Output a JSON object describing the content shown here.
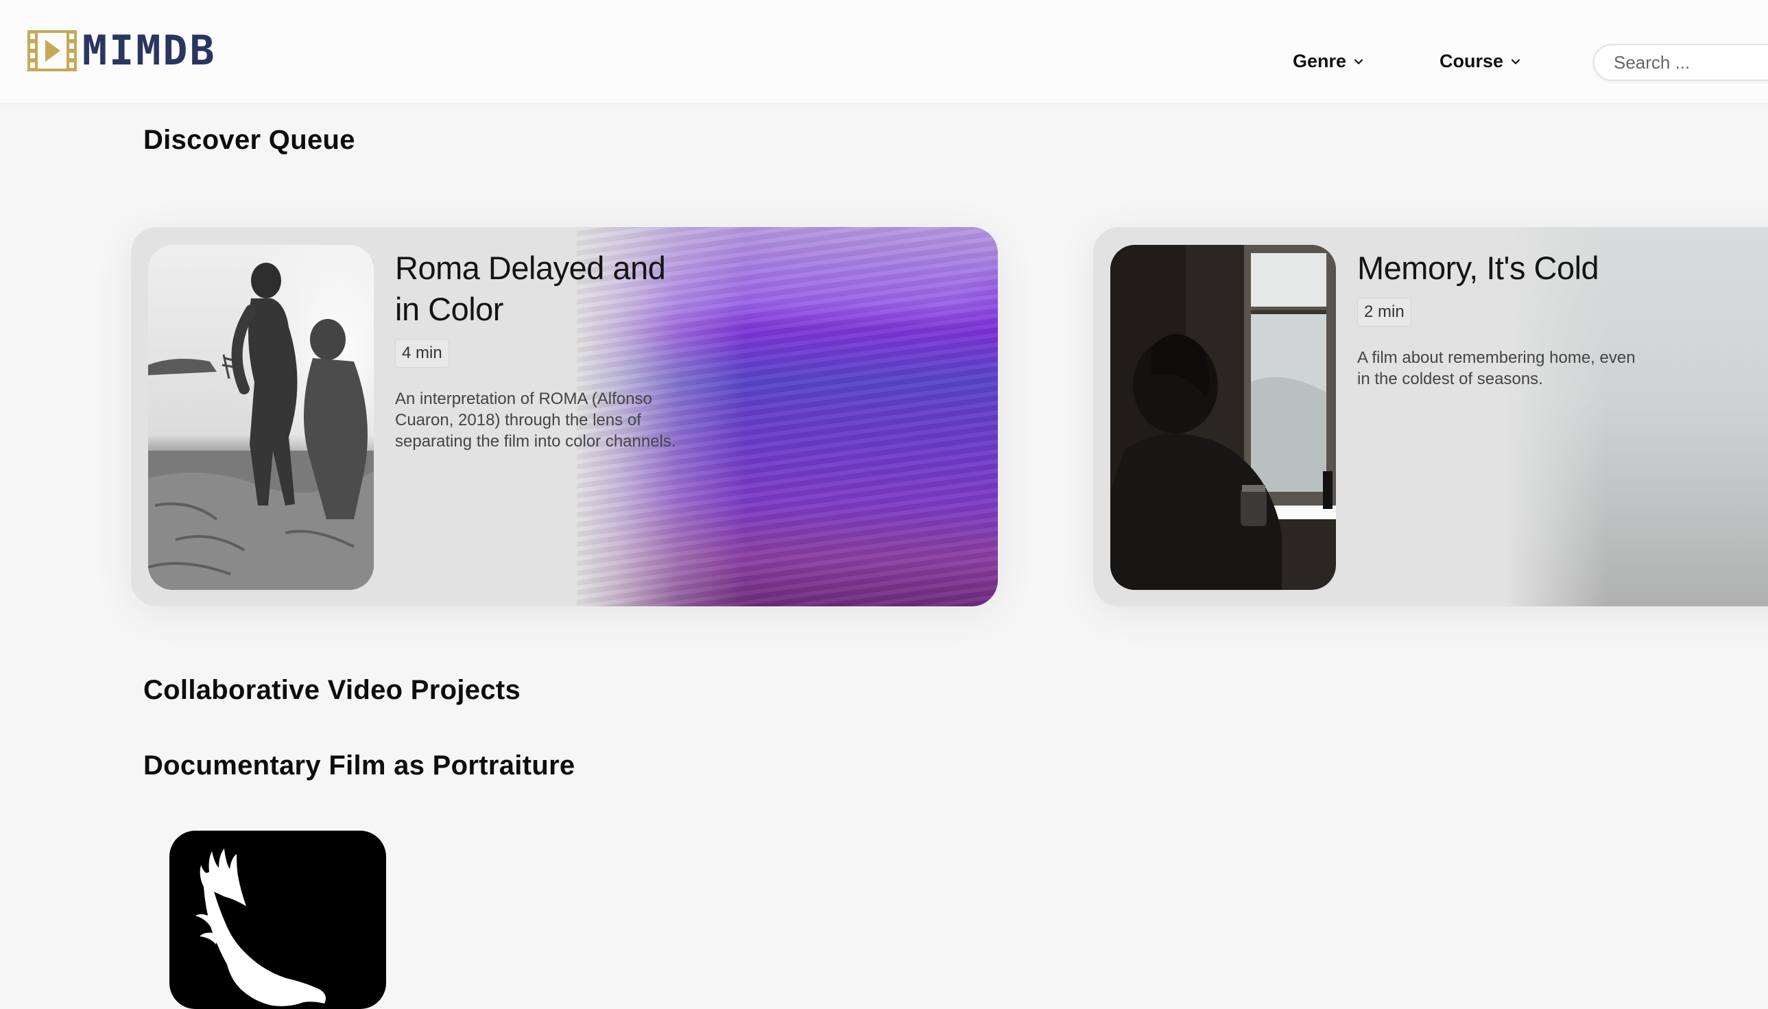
{
  "header": {
    "logo_text": "MIMDB",
    "logo_icon": "film-play-icon",
    "nav": [
      {
        "label": "Genre",
        "icon": "chevron-down-icon"
      },
      {
        "label": "Course",
        "icon": "chevron-down-icon"
      }
    ],
    "search": {
      "placeholder": "Search ..."
    }
  },
  "sections": [
    {
      "title": "Discover Queue",
      "cards": [
        {
          "title": "Roma Delayed and in Color",
          "duration": "4 min",
          "description": "An interpretation of ROMA (Alfonso Cuaron, 2018) through the lens of separating the film into color channels."
        },
        {
          "title": "Memory, It's Cold",
          "duration": "2 min",
          "description": "A film about remembering home, even in the coldest of seasons."
        }
      ]
    },
    {
      "title": "Collaborative Video Projects"
    },
    {
      "title": "Documentary Film as Portraiture",
      "thumb_icon": "eagle-icon"
    }
  ],
  "colors": {
    "logo_gold": "#c4a95a",
    "logo_navy": "#2a3560",
    "accent_purple": "#7f35d8"
  }
}
